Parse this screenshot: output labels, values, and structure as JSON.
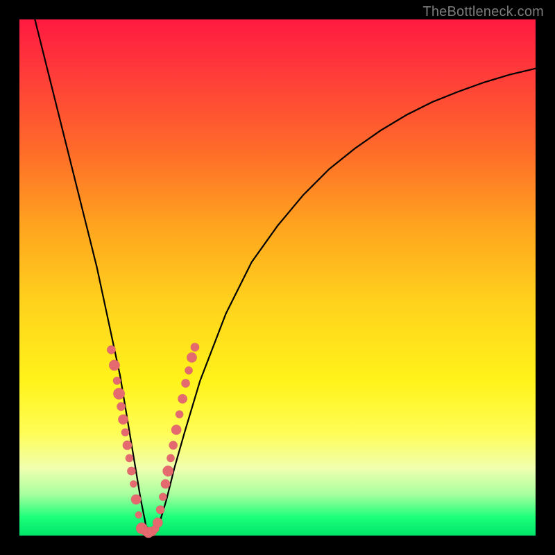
{
  "watermark": "TheBottleneck.com",
  "colors": {
    "dot": "#e46a6f",
    "curve": "#000000"
  },
  "chart_data": {
    "type": "line",
    "title": "",
    "xlabel": "",
    "ylabel": "",
    "xlim": [
      0,
      100
    ],
    "ylim": [
      0,
      100
    ],
    "grid": false,
    "legend": false,
    "series": [
      {
        "name": "bottleneck-curve",
        "x": [
          3,
          5,
          7,
          9,
          11,
          13,
          15,
          16.5,
          18,
          19.5,
          20.5,
          21.5,
          22.5,
          23.5,
          24.5,
          25.5,
          27,
          28.5,
          30,
          32,
          35,
          40,
          45,
          50,
          55,
          60,
          65,
          70,
          75,
          80,
          85,
          90,
          95,
          100
        ],
        "y": [
          100,
          92,
          84,
          76,
          68,
          60,
          52,
          45,
          38,
          31,
          25,
          19,
          13,
          7,
          2,
          0,
          2,
          7,
          13,
          20,
          30,
          43,
          53,
          60,
          66,
          71,
          75,
          78.5,
          81.5,
          84,
          86,
          87.8,
          89.3,
          90.5
        ]
      }
    ],
    "scatter": {
      "name": "data-points",
      "points": [
        {
          "x": 17.8,
          "y": 36,
          "r": 1.2
        },
        {
          "x": 18.4,
          "y": 33,
          "r": 1.5
        },
        {
          "x": 18.9,
          "y": 30,
          "r": 1.1
        },
        {
          "x": 19.3,
          "y": 27.5,
          "r": 1.6
        },
        {
          "x": 19.7,
          "y": 25,
          "r": 1.2
        },
        {
          "x": 20.1,
          "y": 22.5,
          "r": 1.4
        },
        {
          "x": 20.5,
          "y": 20,
          "r": 1.1
        },
        {
          "x": 20.9,
          "y": 17.5,
          "r": 1.3
        },
        {
          "x": 21.3,
          "y": 15,
          "r": 1.1
        },
        {
          "x": 21.7,
          "y": 12.5,
          "r": 1.2
        },
        {
          "x": 22.1,
          "y": 10,
          "r": 1.0
        },
        {
          "x": 22.6,
          "y": 7,
          "r": 1.4
        },
        {
          "x": 23.1,
          "y": 4,
          "r": 1.0
        },
        {
          "x": 23.7,
          "y": 1.4,
          "r": 1.6
        },
        {
          "x": 24.3,
          "y": 0.9,
          "r": 1.2
        },
        {
          "x": 25.0,
          "y": 0.6,
          "r": 1.5
        },
        {
          "x": 25.7,
          "y": 0.8,
          "r": 1.3
        },
        {
          "x": 26.3,
          "y": 1.3,
          "r": 1.1
        },
        {
          "x": 26.8,
          "y": 2.5,
          "r": 1.4
        },
        {
          "x": 27.3,
          "y": 5,
          "r": 1.2
        },
        {
          "x": 27.8,
          "y": 7.5,
          "r": 1.1
        },
        {
          "x": 28.3,
          "y": 10,
          "r": 1.3
        },
        {
          "x": 28.8,
          "y": 12.5,
          "r": 1.5
        },
        {
          "x": 29.3,
          "y": 15,
          "r": 1.1
        },
        {
          "x": 29.8,
          "y": 17.5,
          "r": 1.2
        },
        {
          "x": 30.4,
          "y": 20.5,
          "r": 1.4
        },
        {
          "x": 31.0,
          "y": 23.5,
          "r": 1.1
        },
        {
          "x": 31.6,
          "y": 26.5,
          "r": 1.3
        },
        {
          "x": 32.2,
          "y": 29.5,
          "r": 1.2
        },
        {
          "x": 32.8,
          "y": 32,
          "r": 1.1
        },
        {
          "x": 33.4,
          "y": 34.5,
          "r": 1.4
        },
        {
          "x": 34.0,
          "y": 36.5,
          "r": 1.2
        }
      ]
    }
  }
}
